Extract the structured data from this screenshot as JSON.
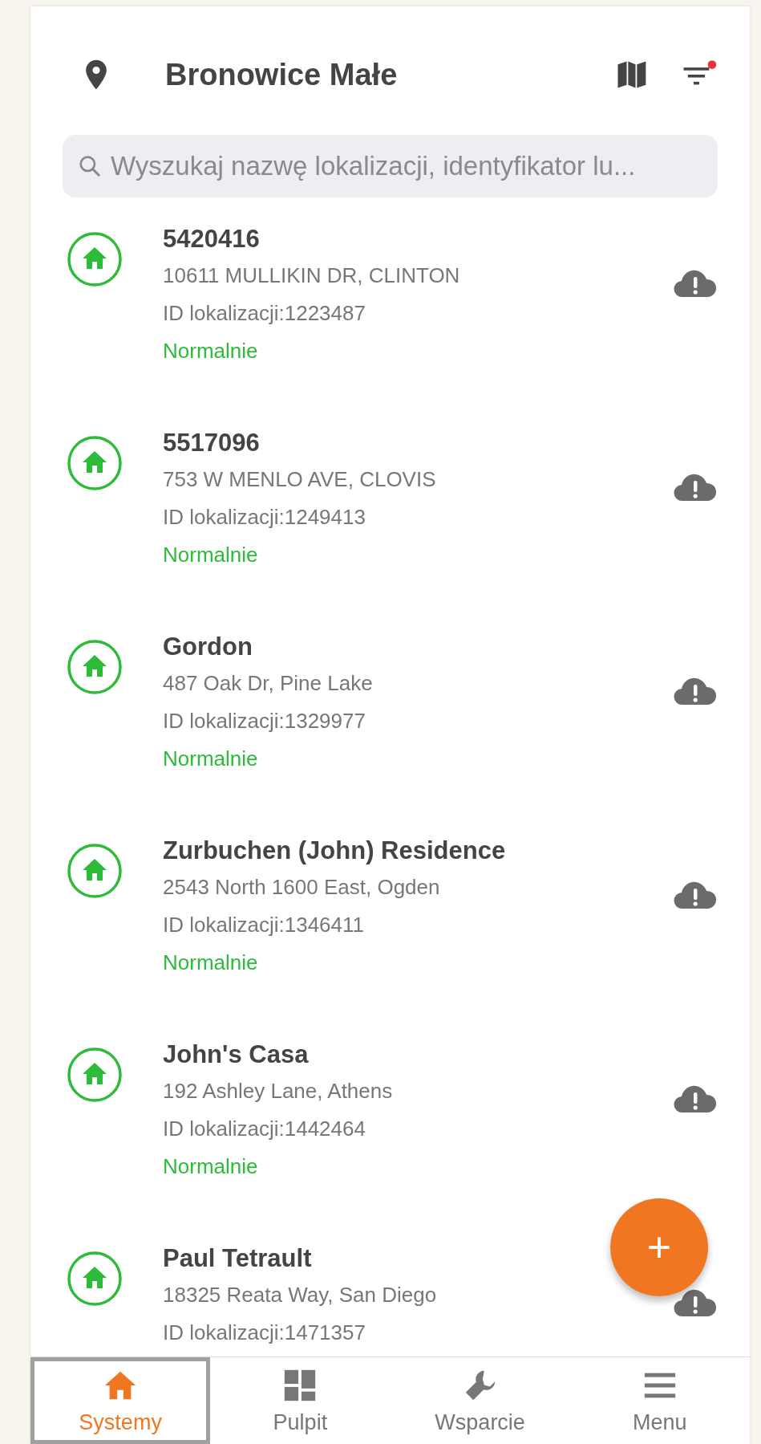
{
  "header": {
    "title": "Bronowice Małe",
    "filter_active": true
  },
  "search": {
    "placeholder": "Wyszukaj nazwę lokalizacji, identyfikator lu..."
  },
  "locations": [
    {
      "name": "5420416",
      "address": "10611 MULLIKIN DR, CLINTON",
      "location_id": "ID lokalizacji:1223487",
      "status": "Normalnie"
    },
    {
      "name": "5517096",
      "address": "753 W MENLO AVE, CLOVIS",
      "location_id": "ID lokalizacji:1249413",
      "status": "Normalnie"
    },
    {
      "name": "Gordon",
      "address": "487 Oak Dr, Pine Lake",
      "location_id": "ID lokalizacji:1329977",
      "status": "Normalnie"
    },
    {
      "name": "Zurbuchen (John) Residence",
      "address": "2543 North 1600 East, Ogden",
      "location_id": "ID lokalizacji:1346411",
      "status": "Normalnie"
    },
    {
      "name": "John's Casa",
      "address": "192 Ashley Lane, Athens",
      "location_id": "ID lokalizacji:1442464",
      "status": "Normalnie"
    },
    {
      "name": "Paul Tetrault",
      "address": "18325 Reata Way, San Diego",
      "location_id": "ID lokalizacji:1471357"
    }
  ],
  "add_button": {
    "label": "+"
  },
  "tabs": [
    {
      "kind": "home",
      "label": "Systemy",
      "selected": true
    },
    {
      "kind": "dashboard",
      "label": "Pulpit",
      "selected": false
    },
    {
      "kind": "support",
      "label": "Wsparcie",
      "selected": false
    },
    {
      "kind": "menu",
      "label": "Menu",
      "selected": false
    }
  ]
}
